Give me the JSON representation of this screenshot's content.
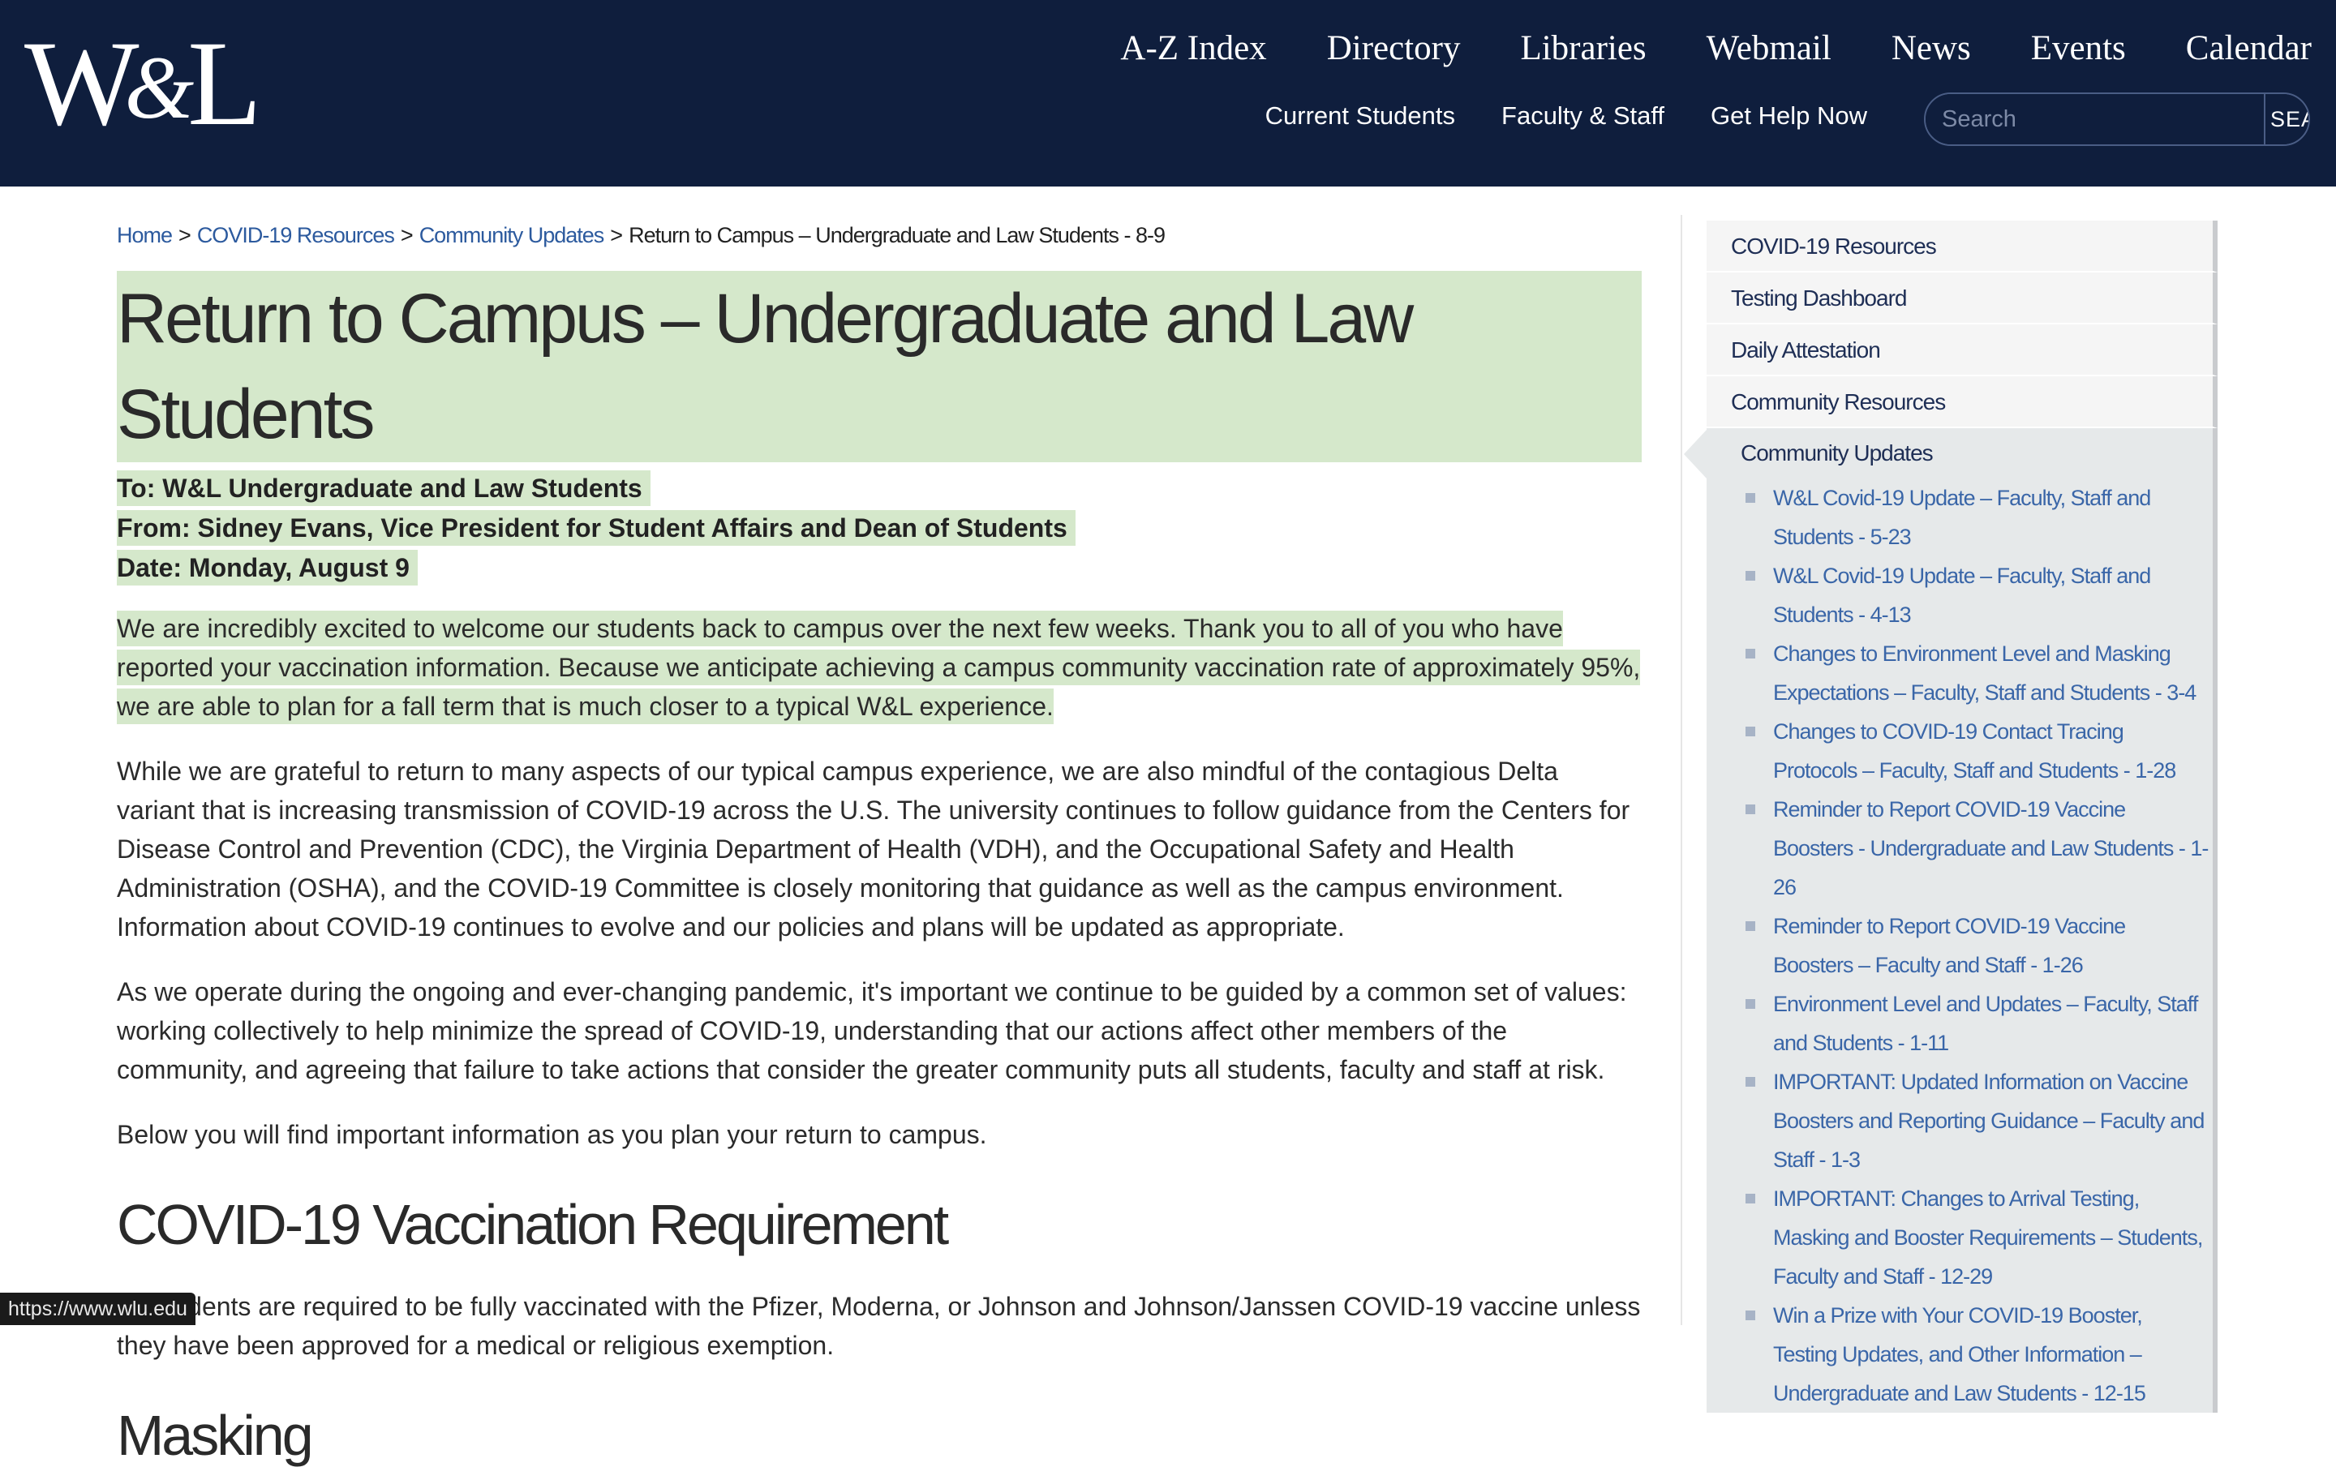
{
  "header": {
    "logo_text": "W&L",
    "logo_left": "W",
    "logo_amp": "&",
    "logo_right": "L",
    "top_nav": [
      "A-Z Index",
      "Directory",
      "Libraries",
      "Webmail",
      "News",
      "Events",
      "Calendar"
    ],
    "sub_nav": [
      "Current Students",
      "Faculty & Staff",
      "Get Help Now"
    ],
    "search": {
      "placeholder": "Search",
      "button_label": "SEARCH"
    }
  },
  "breadcrumb": {
    "items": [
      "Home",
      "COVID-19 Resources",
      "Community Updates"
    ],
    "current": "Return to Campus – Undergraduate and Law Students - 8-9",
    "separator": ">"
  },
  "article": {
    "title": "Return to Campus – Undergraduate and Law Students",
    "to": "To: W&L Undergraduate and Law Students",
    "from": "From: Sidney Evans, Vice President for Student Affairs and Dean of Students",
    "date": "Date: Monday, August 9",
    "paragraph_1": "We are incredibly excited to welcome our students back to campus over the next few weeks. Thank you to all of you who have reported your vaccination information. Because we anticipate achieving a campus community vaccination rate of approximately 95%, we are able to plan for a fall term that is much closer to a typical W&L experience.",
    "paragraph_2": "While we are grateful to return to many aspects of our typical campus experience, we are also mindful of the contagious Delta variant that is increasing transmission of COVID-19 across the U.S. The university continues to follow guidance from the Centers for Disease Control and Prevention (CDC), the Virginia Department of Health (VDH), and the Occupational Safety and Health Administration (OSHA), and the COVID-19 Committee is closely monitoring that guidance as well as the campus environment. Information about COVID-19 continues to evolve and our policies and plans will be updated as appropriate.",
    "paragraph_3": "As we operate during the ongoing and ever-changing pandemic, it's important we continue to be guided by a common set of values: working collectively to help minimize the spread of COVID-19, understanding that our actions affect other members of the community, and agreeing that failure to take actions that consider the greater community puts all students, faculty and staff at risk.",
    "paragraph_4": "Below you will find important information as you plan your return to campus.",
    "heading_vaccination": "COVID-19 Vaccination Requirement",
    "paragraph_vaccination": "All students are required to be fully vaccinated with the Pfizer, Moderna, or Johnson and Johnson/Janssen COVID-19 vaccine unless they have been approved for a medical or religious exemption.",
    "heading_masking": "Masking"
  },
  "sidebar": {
    "items": [
      "COVID-19 Resources",
      "Testing Dashboard",
      "Daily Attestation",
      "Community Resources"
    ],
    "active": "Community Updates",
    "subitems": [
      "W&L Covid-19 Update – Faculty, Staff and Students - 5-23",
      "W&L Covid-19 Update – Faculty, Staff and Students - 4-13",
      "Changes to Environment Level and Masking Expectations – Faculty, Staff and Students - 3-4",
      "Changes to COVID-19 Contact Tracing Protocols – Faculty, Staff and Students - 1-28",
      "Reminder to Report COVID-19 Vaccine Boosters - Undergraduate and Law Students - 1-26",
      "Reminder to Report COVID-19 Vaccine Boosters – Faculty and Staff - 1-26",
      "Environment Level and Updates – Faculty, Staff and Students - 1-11",
      "IMPORTANT: Updated Information on Vaccine Boosters and Reporting Guidance – Faculty and Staff - 1-3",
      "IMPORTANT: Changes to Arrival Testing, Masking and Booster Requirements – Students, Faculty and Staff - 12-29",
      "Win a Prize with Your COVID-19 Booster, Testing Updates, and Other Information – Undergraduate and Law Students - 12-15"
    ]
  },
  "status_bar": {
    "url": "https://www.wlu.edu"
  },
  "colors": {
    "header_bg": "#0f1e3d",
    "highlight": "#d5e8cb",
    "link": "#2c5a9e",
    "sidebar_link": "#3a66a8"
  }
}
